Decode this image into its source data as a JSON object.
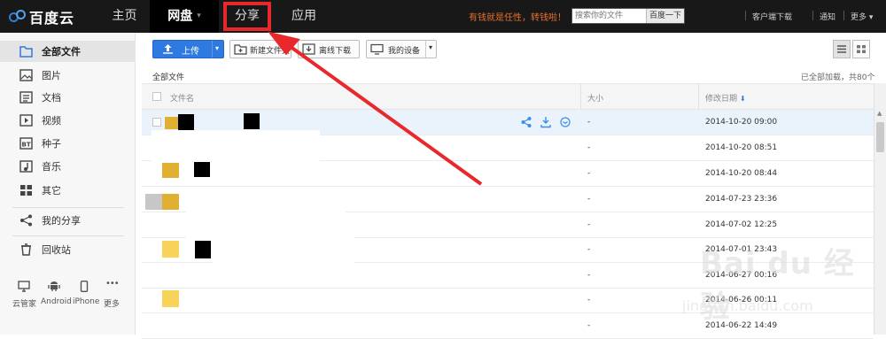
{
  "topbar": {
    "logo_text": "百度云",
    "nav": [
      {
        "label": "主页"
      },
      {
        "label": "网盘",
        "caret": "▾"
      },
      {
        "label": "分享"
      },
      {
        "label": "应用"
      }
    ],
    "promo": "有钱就是任性，转钱啦！",
    "search_placeholder": "搜索你的文件",
    "search_button": "百度一下",
    "links": [
      "客户端下载",
      "通知",
      "更多"
    ],
    "more_caret": "▾"
  },
  "sidebar": {
    "items": [
      {
        "label": "全部文件",
        "icon": "folder-icon",
        "active": true
      },
      {
        "label": "图片",
        "icon": "image-icon"
      },
      {
        "label": "文档",
        "icon": "document-icon"
      },
      {
        "label": "视频",
        "icon": "video-icon"
      },
      {
        "label": "种子",
        "icon": "torrent-icon",
        "badge": "BT"
      },
      {
        "label": "音乐",
        "icon": "music-icon"
      },
      {
        "label": "其它",
        "icon": "grid-icon"
      },
      {
        "label": "我的分享",
        "icon": "share-icon"
      },
      {
        "label": "回收站",
        "icon": "trash-icon"
      }
    ],
    "devices": [
      {
        "label": "云管家",
        "icon": "monitor-icon"
      },
      {
        "label": "Android",
        "icon": "android-icon"
      },
      {
        "label": "iPhone",
        "icon": "phone-icon"
      },
      {
        "label": "更多",
        "icon": "more-dots-icon",
        "glyph": "•••"
      }
    ]
  },
  "toolbar": {
    "upload": "上传",
    "new_folder": "新建文件夹",
    "offline_download": "离线下载",
    "my_devices": "我的设备",
    "caret": "▾"
  },
  "breadcrumb": "全部文件",
  "count_text": "已全部加载，共80个",
  "table": {
    "headers": {
      "name": "文件名",
      "size": "大小",
      "date": "修改日期",
      "sort_glyph": "⬇"
    },
    "rows": [
      {
        "size": "-",
        "date": "2014-10-20 09:00",
        "selected": true
      },
      {
        "size": "-",
        "date": "2014-10-20 08:51"
      },
      {
        "size": "-",
        "date": "2014-10-20 08:44"
      },
      {
        "size": "-",
        "date": "2014-07-23 23:36"
      },
      {
        "size": "-",
        "date": "2014-07-02 12:25"
      },
      {
        "size": "-",
        "date": "2014-07-01 23:43"
      },
      {
        "size": "-",
        "date": "2014-06-27 00:16"
      },
      {
        "size": "-",
        "date": "2014-06-26 00:11"
      },
      {
        "size": "-",
        "date": "2014-06-22 14:49"
      }
    ]
  },
  "scrollbar": {
    "up_glyph": "▲"
  },
  "colors": {
    "accent": "#2e7ae0",
    "highlight": "#e8282b",
    "promo": "#e4712d",
    "topbar": "#181818"
  },
  "watermark": {
    "logo": "Bai du 经验",
    "url": "jingyan.baidu.com"
  }
}
